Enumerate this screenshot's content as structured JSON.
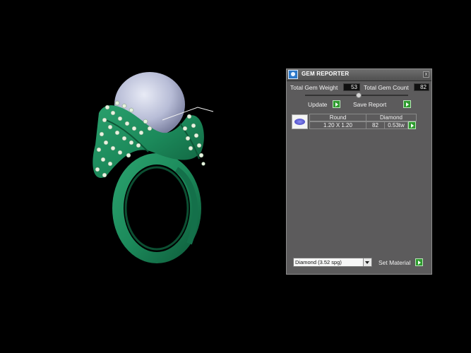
{
  "panel": {
    "title": "GEM REPORTER",
    "close_glyph": "x",
    "total_weight_label": "Total Gem Weight",
    "total_weight_value": "53",
    "total_count_label": "Total Gem Count",
    "total_count_value": "82",
    "update_label": "Update",
    "save_report_label": "Save Report",
    "table": {
      "headers": [
        "Round",
        "Diamond"
      ],
      "row": {
        "size": "1.20 X 1.20",
        "count": "82",
        "weight": "0.53tw"
      }
    },
    "material_select_value": "Diamond     (3.52 spg)",
    "set_material_label": "Set Material"
  },
  "colors": {
    "ring": "#1e8a5c",
    "pearl": "#c8cde4",
    "panel_bg": "#5c5b5c",
    "accent_button": "#2e9b2e"
  },
  "icons": [
    "gem-reporter-app-icon",
    "close-icon",
    "play-arrow-icon",
    "round-gem-icon",
    "dropdown-arrow-icon"
  ]
}
